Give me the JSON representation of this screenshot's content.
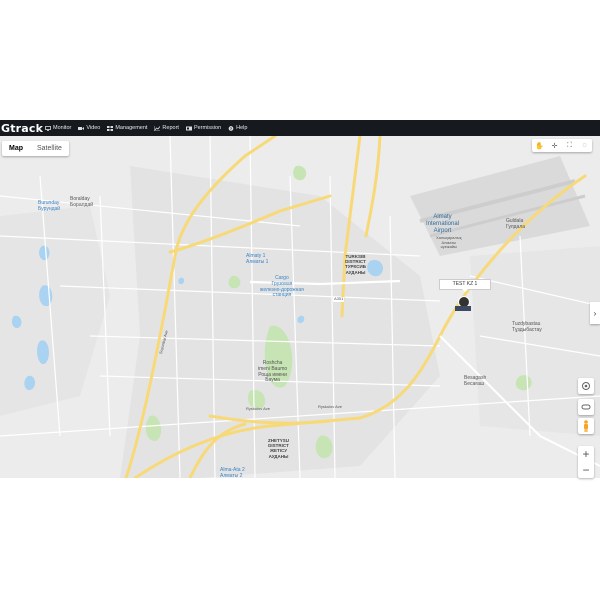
{
  "header": {
    "logo": "Gtrack",
    "nav": [
      {
        "label": "Monitor",
        "icon": "monitor-icon"
      },
      {
        "label": "Video",
        "icon": "video-icon"
      },
      {
        "label": "Management",
        "icon": "grid-icon"
      },
      {
        "label": "Report",
        "icon": "chart-icon"
      },
      {
        "label": "Permission",
        "icon": "permission-icon"
      },
      {
        "label": "Help",
        "icon": "help-icon"
      }
    ]
  },
  "map": {
    "types": [
      {
        "label": "Map",
        "active": true
      },
      {
        "label": "Satellite",
        "active": false
      }
    ],
    "tools": [
      "hand-icon",
      "crosshair-icon",
      "fullscreen-icon",
      "chat-icon"
    ],
    "vehicle": {
      "label": "TEST KZ 1"
    },
    "labels": {
      "burunday": "Burunday\nБурундай",
      "borolday": "Boralday\nБоралдай",
      "airport": "Almaty\nInternational\nAirport",
      "airport_sub": "Халықаралық\nАлматы\nәуежайы",
      "guldala": "Guldala\nГулдала",
      "almaty1": "Almaty 1\nАлматы 1",
      "station": "Cargo\nГрузовая\nжелезно-дорожная\nстанция",
      "turksib": "TURKSIB\nDISTRICT\nТУРКСИБ\nАУДАНЫ",
      "tuzdybastau": "Tuzdybastau\nТұздыбастау",
      "besagash": "Besagash\nБесағаш",
      "roshcha": "Roshcha\nimeni Baumo\nРоща имени\nБаума",
      "zhetysu": "ZHETYSU\nDISTRICT\nЖЕТІСУ\nАУДАНЫ",
      "almaata2": "Alma-Ata 2\nАлматы 2"
    },
    "roads": {
      "ryskulov": "Ryskulov Ave",
      "suyunbai": "Suyunbai Ave",
      "a351": "A351"
    }
  },
  "colors": {
    "topbar": "#161a1f",
    "map_bg": "#ececec",
    "highway": "#f8d978",
    "water": "#aad3f2",
    "park": "#c6e4b4"
  }
}
